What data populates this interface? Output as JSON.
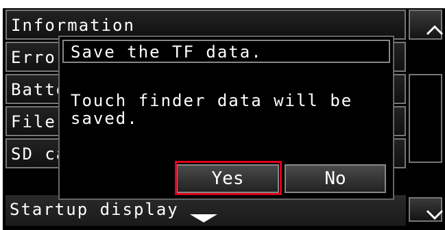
{
  "menu": {
    "items": [
      {
        "label": "Information"
      },
      {
        "label": "Error"
      },
      {
        "label": "Battery"
      },
      {
        "label": "File"
      },
      {
        "label": "SD card"
      }
    ],
    "footer_label": "Startup display"
  },
  "scroll": {
    "up_icon": "chevron-up-icon",
    "down_icon": "chevron-down-icon"
  },
  "dialog": {
    "title": "Save the TF data.",
    "message": "Touch finder data will be saved.",
    "yes_label": "Yes",
    "no_label": "No",
    "highlight_color": "#e0001a"
  }
}
